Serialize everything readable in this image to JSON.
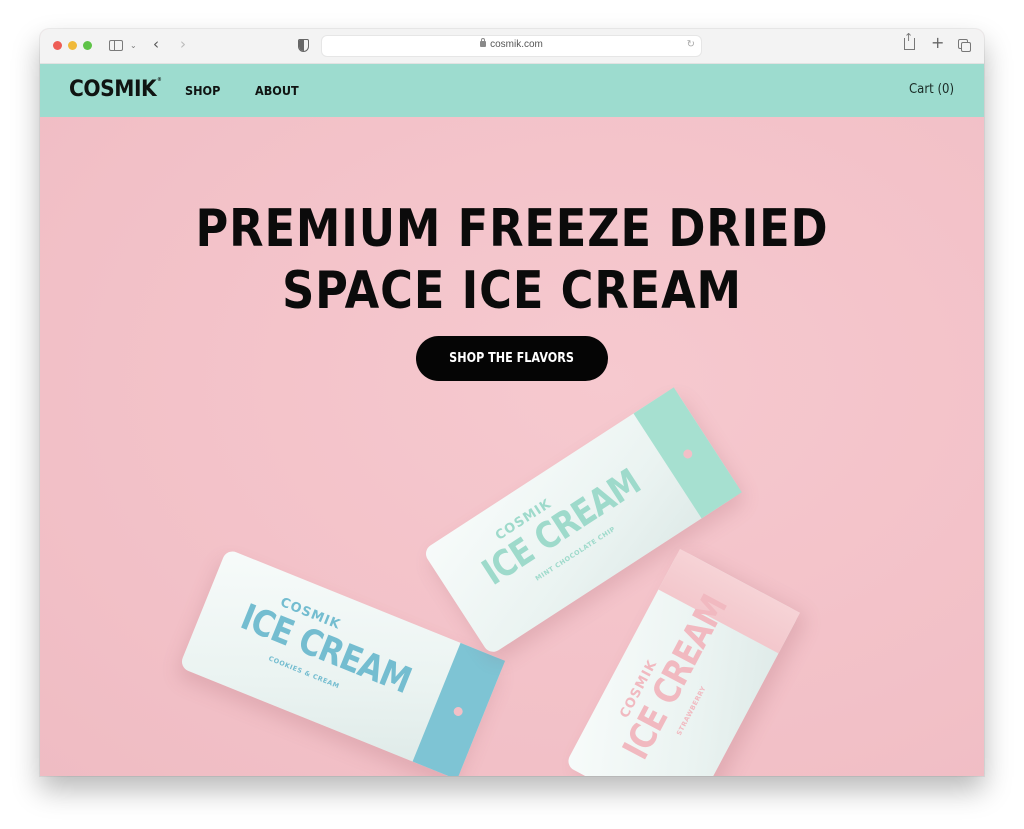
{
  "browser": {
    "url": "cosmik.com",
    "icons": {
      "sidebar": "sidebar-icon",
      "back": "chevron-left-icon",
      "forward": "chevron-right-icon",
      "privacy": "shield-icon",
      "lock": "lock-icon",
      "reload": "reload-icon",
      "share": "share-icon",
      "new_tab": "plus-icon",
      "tabs": "tabs-overview-icon"
    }
  },
  "nav": {
    "logo": "COSMIK",
    "logo_mark": "®",
    "links": [
      {
        "label": "SHOP"
      },
      {
        "label": "ABOUT"
      }
    ],
    "cart_label": "Cart (0)"
  },
  "hero": {
    "headline_line1": "PREMIUM FREEZE DRIED",
    "headline_line2": "SPACE ICE CREAM",
    "cta_label": "SHOP THE FLAVORS"
  },
  "products": [
    {
      "brand": "COSMIK",
      "name": "ICE CREAM",
      "flavor": "MINT CHOCOLATE CHIP",
      "accent": "#a6e0d0"
    },
    {
      "brand": "COSMIK",
      "name": "ICE CREAM",
      "flavor": "COOKIES & CREAM",
      "accent": "#7ec4d4"
    },
    {
      "brand": "COSMIK",
      "name": "ICE CREAM",
      "flavor": "STRAWBERRY",
      "accent": "#f3c7cc"
    }
  ],
  "colors": {
    "nav_bg": "#9ddccf",
    "hero_bg": "#f2c0c7",
    "cta_bg": "#050505",
    "text": "#0b0b0b"
  }
}
